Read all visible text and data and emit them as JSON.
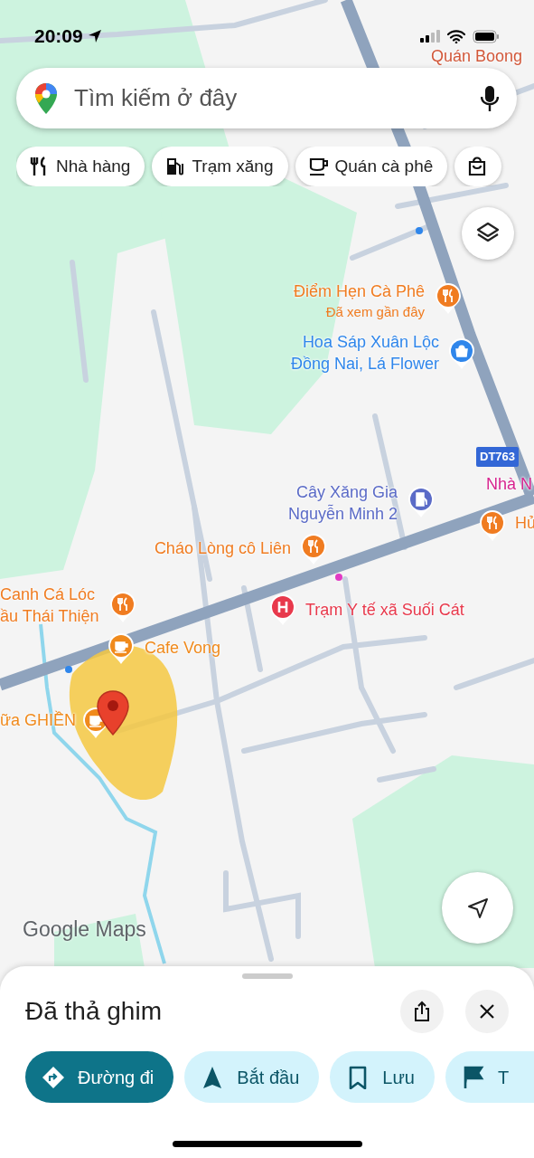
{
  "status_bar": {
    "time": "20:09"
  },
  "search": {
    "placeholder": "Tìm kiếm ở đây"
  },
  "chips": [
    {
      "kind": "restaurant",
      "label": "Nhà hàng"
    },
    {
      "kind": "gas",
      "label": "Trạm xăng"
    },
    {
      "kind": "cafe",
      "label": "Quán cà phê"
    },
    {
      "kind": "shopping"
    }
  ],
  "map": {
    "road_shield": "DT763",
    "logo": "Google Maps",
    "places": [
      {
        "kind": "none",
        "lines": [
          "Quán Boong"
        ],
        "color": "#d2583a"
      },
      {
        "kind": "restaurant",
        "lines": [
          "Điểm Hẹn Cà Phê"
        ],
        "subtitle": "Đã xem gần đây",
        "color": "#f07c21"
      },
      {
        "kind": "shopping",
        "lines": [
          "Hoa Sáp Xuân Lộc",
          "Đồng Nai, Lá Flower"
        ],
        "color": "#2f86eb"
      },
      {
        "kind": "gas",
        "lines": [
          "Cây Xăng Gia",
          "Nguyễn Minh 2"
        ],
        "color": "#5b6bc7"
      },
      {
        "kind": "none",
        "lines": [
          "Nhà N"
        ],
        "color": "#d7248f"
      },
      {
        "kind": "restaurant",
        "lines": [
          "Hủ"
        ],
        "color": "#f07c21"
      },
      {
        "kind": "restaurant",
        "lines": [
          "Cháo Lòng cô Liên"
        ],
        "color": "#f07c21"
      },
      {
        "kind": "restaurant",
        "lines": [
          "Canh Cá Lóc",
          "ầu Thái Thiện"
        ],
        "color": "#f07c21"
      },
      {
        "kind": "hospital",
        "lines": [
          "Trạm Y tế xã Suối Cát"
        ],
        "color": "#e8394c"
      },
      {
        "kind": "cafe",
        "lines": [
          "Cafe Vong"
        ],
        "color": "#f08a1c"
      },
      {
        "kind": "cafe",
        "lines": [
          "ữa GHIỀN"
        ],
        "color": "#f08a1c"
      }
    ]
  },
  "sheet": {
    "title": "Đã thả ghim",
    "actions": [
      {
        "kind": "directions",
        "label": "Đường đi",
        "primary": true
      },
      {
        "kind": "start",
        "label": "Bắt đầu",
        "primary": false
      },
      {
        "kind": "save",
        "label": "Lưu",
        "primary": false
      },
      {
        "kind": "flag",
        "label": "T",
        "primary": false
      }
    ]
  }
}
